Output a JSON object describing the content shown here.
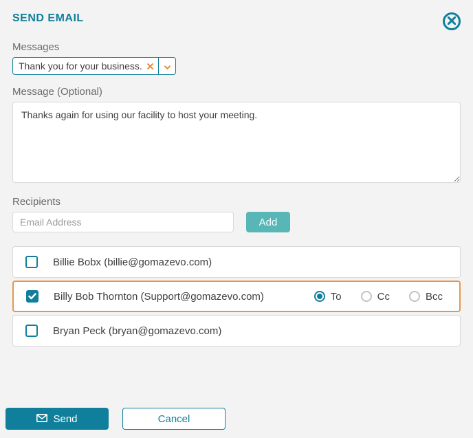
{
  "header": {
    "title": "SEND EMAIL"
  },
  "messages": {
    "label": "Messages",
    "selected": "Thank you for your business."
  },
  "message": {
    "label": "Message (Optional)",
    "value": "Thanks again for using our facility to host your meeting."
  },
  "recipients": {
    "label": "Recipients",
    "email_placeholder": "Email Address",
    "add_label": "Add",
    "dest_options": {
      "to": "To",
      "cc": "Cc",
      "bcc": "Bcc"
    },
    "list": [
      {
        "display": "Billie Bobx (billie@gomazevo.com)",
        "checked": false
      },
      {
        "display": "Billy Bob Thornton (Support@gomazevo.com)",
        "checked": true,
        "dest": "to"
      },
      {
        "display": "Bryan Peck (bryan@gomazevo.com)",
        "checked": false
      }
    ]
  },
  "footer": {
    "send": "Send",
    "cancel": "Cancel"
  }
}
